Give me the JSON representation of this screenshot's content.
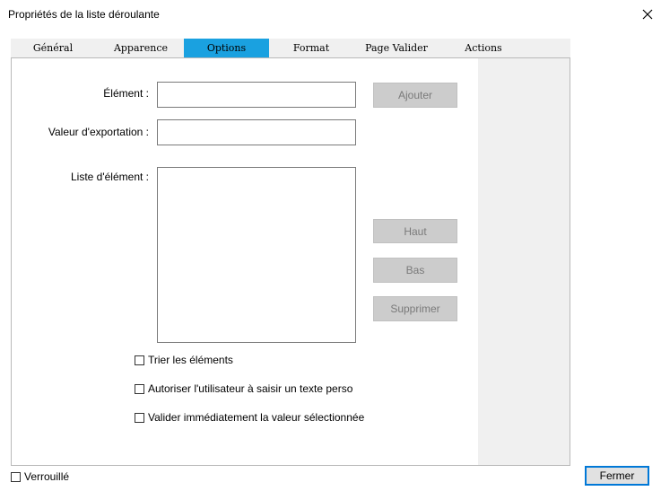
{
  "window": {
    "title": "Propriétés de la liste déroulante",
    "close_icon": "close-icon"
  },
  "tabs": [
    {
      "label": "Général"
    },
    {
      "label": "Apparence"
    },
    {
      "label": "Options",
      "active": true
    },
    {
      "label": "Format"
    },
    {
      "label": "Page Valider"
    },
    {
      "label": "Actions"
    }
  ],
  "form": {
    "element_label": "Élément :",
    "element_value": "",
    "export_label": "Valeur d'exportation :",
    "export_value": "",
    "list_label": "Liste d'élément :"
  },
  "buttons": {
    "add": "Ajouter",
    "up": "Haut",
    "down": "Bas",
    "delete": "Supprimer"
  },
  "options": {
    "sort": {
      "label": "Trier les éléments",
      "checked": false
    },
    "custom": {
      "label": "Autoriser l'utilisateur à saisir un texte perso",
      "checked": false
    },
    "commit": {
      "label": "Valider immédiatement la valeur sélectionnée",
      "checked": false
    }
  },
  "footer": {
    "locked": {
      "label": "Verrouillé",
      "checked": false
    },
    "close_label": "Fermer"
  },
  "colors": {
    "active_tab": "#1aa1e0",
    "default_button_border": "#0078d7"
  }
}
